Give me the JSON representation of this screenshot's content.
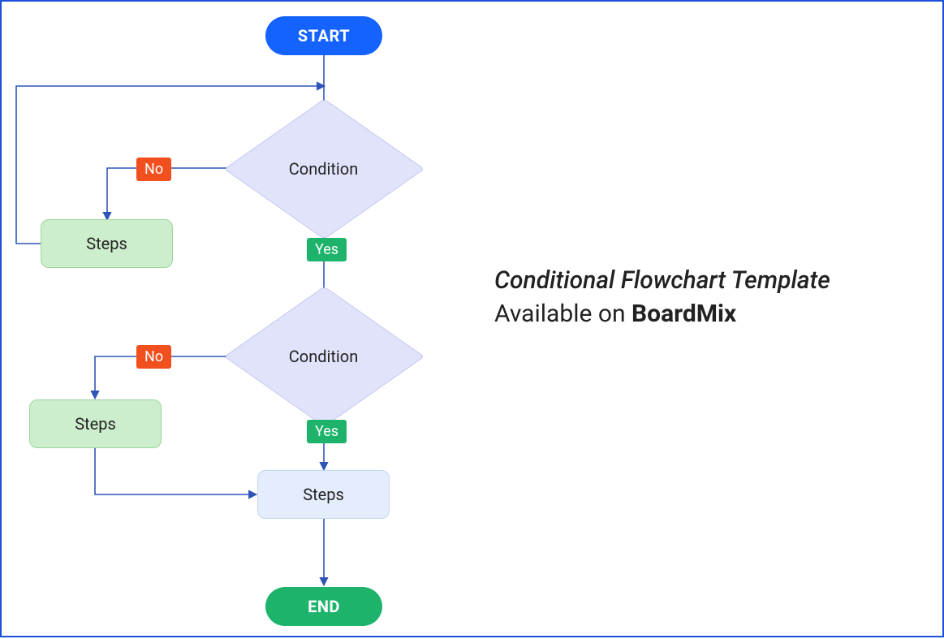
{
  "flowchart": {
    "start": "START",
    "condition1": "Condition",
    "condition2": "Condition",
    "steps_left_1": "Steps",
    "steps_left_2": "Steps",
    "steps_main": "Steps",
    "end": "END",
    "yes1": "Yes",
    "yes2": "Yes",
    "no1": "No",
    "no2": "No"
  },
  "caption": {
    "title": "Conditional Flowchart Template",
    "available": "Available on ",
    "brand": "BoardMix"
  },
  "colors": {
    "border": "#1d4ed8",
    "start": "#1463ff",
    "end": "#1db36b",
    "diamond": "#e1e3fb",
    "process_green": "#cdeecd",
    "process_blue": "#e4edfc",
    "yes": "#1db36b",
    "no": "#f24f1f",
    "line": "#2e55b5"
  }
}
